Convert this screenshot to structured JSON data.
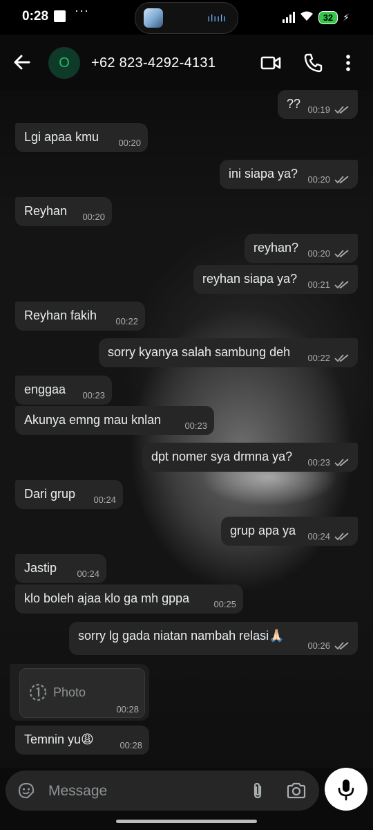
{
  "status_bar": {
    "time": "0:28",
    "battery": "32"
  },
  "header": {
    "avatar_letter": "O",
    "contact": "+62 823-4292-4131"
  },
  "messages": [
    {
      "dir": "out",
      "text": "??",
      "time": "00:19"
    },
    {
      "dir": "in",
      "text": "Lgi apaa kmu",
      "time": "00:20"
    },
    {
      "dir": "out",
      "text": "ini siapa ya?",
      "time": "00:20"
    },
    {
      "dir": "in",
      "text": "Reyhan",
      "time": "00:20"
    },
    {
      "dir": "out",
      "text": "reyhan?",
      "time": "00:20"
    },
    {
      "dir": "out",
      "text": "reyhan siapa ya?",
      "time": "00:21"
    },
    {
      "dir": "in",
      "text": "Reyhan fakih",
      "time": "00:22"
    },
    {
      "dir": "out",
      "text": "sorry kyanya salah sambung deh",
      "time": "00:22"
    },
    {
      "dir": "in",
      "text": "enggaa",
      "time": "00:23"
    },
    {
      "dir": "in",
      "text": "Akunya emng mau knlan",
      "time": "00:23"
    },
    {
      "dir": "out",
      "text": "dpt nomer sya drmna ya?",
      "time": "00:23"
    },
    {
      "dir": "in",
      "text": "Dari grup",
      "time": "00:24"
    },
    {
      "dir": "out",
      "text": "grup apa ya",
      "time": "00:24"
    },
    {
      "dir": "in",
      "text": "Jastip",
      "time": "00:24"
    },
    {
      "dir": "in",
      "text": "klo boleh ajaa klo ga mh gppa",
      "time": "00:25"
    },
    {
      "dir": "out",
      "text": "sorry lg gada niatan nambah relasi🙏🏻",
      "time": "00:26"
    },
    {
      "dir": "in",
      "text": "Temnin yu😩",
      "time": "00:28"
    }
  ],
  "photo_message": {
    "label": "Photo",
    "time": "00:28"
  },
  "composer": {
    "placeholder": "Message"
  },
  "colors": {
    "bubble": "#262626",
    "accent": "#21c063",
    "tick": "#a9aeb1"
  }
}
